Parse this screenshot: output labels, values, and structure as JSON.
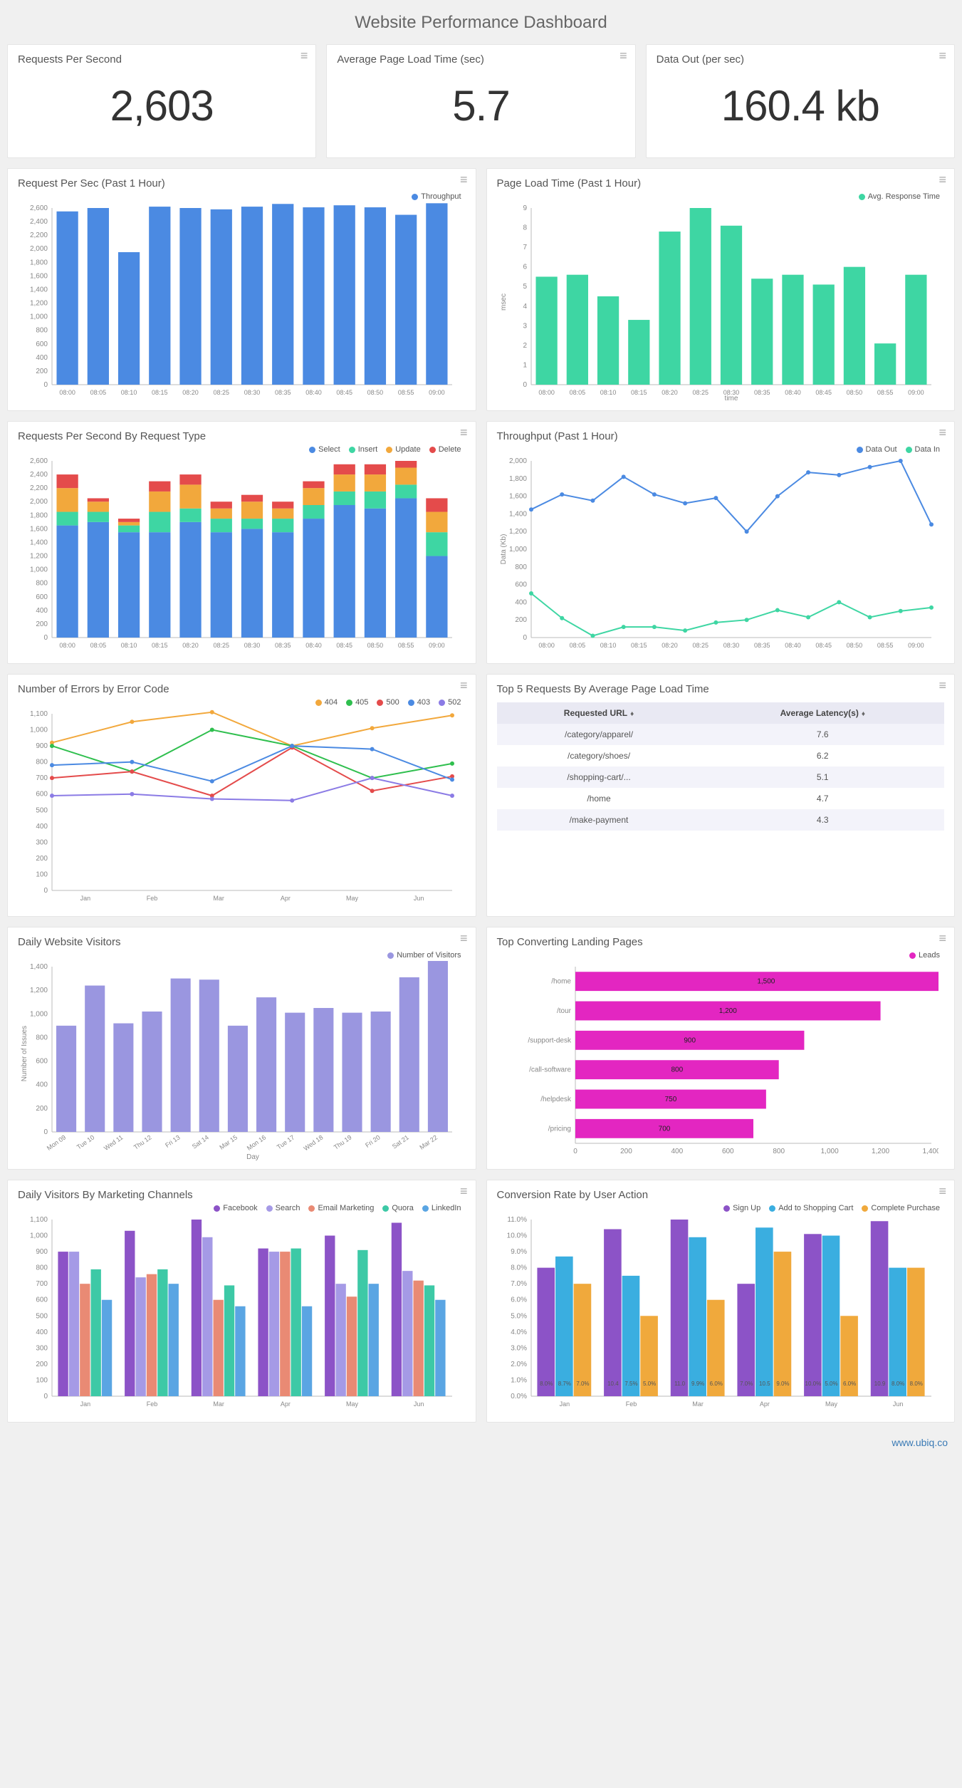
{
  "title": "Website Performance Dashboard",
  "footer": "www.ubiq.co",
  "kpis": {
    "rps": {
      "label": "Requests Per Second",
      "value": "2,603"
    },
    "plt": {
      "label": "Average Page Load Time (sec)",
      "value": "5.7"
    },
    "out": {
      "label": "Data Out (per sec)",
      "value": "160.4 kb"
    }
  },
  "colors": {
    "blue": "#4b8ae2",
    "teal": "#3ed6a3",
    "orange": "#f2a83c",
    "red": "#e44b4b",
    "green": "#2fbf4e",
    "purple": "#8b7be5",
    "lilac": "#9a96e0",
    "magenta": "#e326c1",
    "fbPurple": "#8c53c7",
    "searchLilac": "#a59ae6",
    "emailCoral": "#e98a74",
    "quoraTeal": "#3dc9a6",
    "linkedinBlue": "#5aa5e3",
    "signPurple": "#8c53c7",
    "cartBlue": "#3aaee0",
    "completeOrange": "#f0a93c"
  },
  "rps_hour": {
    "title": "Request Per Sec (Past 1 Hour)",
    "legend": "Throughput"
  },
  "plt_hour": {
    "title": "Page Load Time (Past 1 Hour)",
    "legend": "Avg. Response Time",
    "ylabel": "msec"
  },
  "rps_type": {
    "title": "Requests Per Second By Request Type",
    "legend": {
      "a": "Select",
      "b": "Insert",
      "c": "Update",
      "d": "Delete"
    }
  },
  "throughput": {
    "title": "Throughput (Past 1 Hour)",
    "legend": {
      "a": "Data Out",
      "b": "Data In"
    },
    "ylabel": "Data (Kb)"
  },
  "errors": {
    "title": "Number of Errors by Error Code",
    "legend": {
      "a": "404",
      "b": "405",
      "c": "500",
      "d": "403",
      "e": "502"
    }
  },
  "top5": {
    "title": "Top 5 Requests By Average Page Load Time",
    "col1": "Requested URL",
    "col2": "Average Latency(s)",
    "rows": [
      {
        "url": "/category/apparel/",
        "lat": "7.6"
      },
      {
        "url": "/category/shoes/",
        "lat": "6.2"
      },
      {
        "url": "/shopping-cart/...",
        "lat": "5.1"
      },
      {
        "url": "/home",
        "lat": "4.7"
      },
      {
        "url": "/make-payment",
        "lat": "4.3"
      }
    ]
  },
  "visitors": {
    "title": "Daily Website Visitors",
    "legend": "Number of Visitors",
    "ylabel": "Number of Issues",
    "xlabel": "Day"
  },
  "landing": {
    "title": "Top Converting Landing Pages",
    "legend": "Leads"
  },
  "channels": {
    "title": "Daily Visitors By Marketing Channels",
    "legend": {
      "a": "Facebook",
      "b": "Search",
      "c": "Email Marketing",
      "d": "Quora",
      "e": "LinkedIn"
    }
  },
  "conversion": {
    "title": "Conversion Rate by User Action",
    "legend": {
      "a": "Sign Up",
      "b": "Add to Shopping Cart",
      "c": "Complete Purchase"
    }
  },
  "chart_data": [
    {
      "id": "rps_hour",
      "type": "bar",
      "categories": [
        "08:00",
        "08:05",
        "08:10",
        "08:15",
        "08:20",
        "08:25",
        "08:30",
        "08:35",
        "08:40",
        "08:45",
        "08:50",
        "08:55",
        "09:00"
      ],
      "series": [
        {
          "name": "Throughput",
          "values": [
            2550,
            2600,
            1950,
            2620,
            2600,
            2580,
            2620,
            2660,
            2610,
            2640,
            2610,
            2500,
            2670
          ]
        }
      ],
      "ylim": [
        0,
        2600
      ],
      "yticks": [
        0,
        200,
        400,
        600,
        800,
        1000,
        1200,
        1400,
        1600,
        1800,
        2000,
        2200,
        2400,
        2600
      ]
    },
    {
      "id": "plt_hour",
      "type": "bar",
      "categories": [
        "08:00",
        "08:05",
        "08:10",
        "08:15",
        "08:20",
        "08:25",
        "08:30",
        "08:35",
        "08:40",
        "08:45",
        "08:50",
        "08:55",
        "09:00"
      ],
      "series": [
        {
          "name": "Avg. Response Time",
          "values": [
            5.5,
            5.6,
            4.5,
            3.3,
            7.8,
            9.0,
            8.1,
            5.4,
            5.6,
            5.1,
            6.0,
            2.1,
            5.6
          ]
        }
      ],
      "ylim": [
        0,
        9
      ],
      "yticks": [
        0,
        1,
        2,
        3,
        4,
        5,
        6,
        7,
        8,
        9
      ],
      "xlabel": "time"
    },
    {
      "id": "rps_type",
      "type": "stacked-bar",
      "categories": [
        "08:00",
        "08:05",
        "08:10",
        "08:15",
        "08:20",
        "08:25",
        "08:30",
        "08:35",
        "08:40",
        "08:45",
        "08:50",
        "08:55",
        "09:00"
      ],
      "series": [
        {
          "name": "Select",
          "values": [
            1650,
            1700,
            1550,
            1550,
            1700,
            1550,
            1600,
            1550,
            1750,
            1950,
            1900,
            2050,
            1200
          ]
        },
        {
          "name": "Insert",
          "values": [
            200,
            150,
            100,
            300,
            200,
            200,
            150,
            200,
            200,
            200,
            250,
            200,
            350
          ]
        },
        {
          "name": "Update",
          "values": [
            350,
            150,
            50,
            300,
            350,
            150,
            250,
            150,
            250,
            250,
            250,
            250,
            300
          ]
        },
        {
          "name": "Delete",
          "values": [
            200,
            50,
            50,
            150,
            150,
            100,
            100,
            100,
            100,
            150,
            150,
            100,
            200
          ]
        }
      ],
      "ylim": [
        0,
        2600
      ],
      "yticks": [
        0,
        200,
        400,
        600,
        800,
        1000,
        1200,
        1400,
        1600,
        1800,
        2000,
        2200,
        2400,
        2600
      ]
    },
    {
      "id": "throughput",
      "type": "line",
      "categories": [
        "08:00",
        "08:05",
        "08:10",
        "08:15",
        "08:20",
        "08:25",
        "08:30",
        "08:35",
        "08:40",
        "08:45",
        "08:50",
        "08:55",
        "09:00"
      ],
      "series": [
        {
          "name": "Data Out",
          "values": [
            1450,
            1620,
            1550,
            1820,
            1620,
            1520,
            1580,
            1200,
            1600,
            1870,
            1840,
            1930,
            2000,
            1280
          ]
        },
        {
          "name": "Data In",
          "values": [
            500,
            220,
            20,
            120,
            120,
            80,
            170,
            200,
            310,
            230,
            400,
            230,
            300,
            340
          ]
        }
      ],
      "ylim": [
        0,
        2000
      ],
      "yticks": [
        0,
        200,
        400,
        600,
        800,
        1000,
        1200,
        1400,
        1600,
        1800,
        2000
      ]
    },
    {
      "id": "errors",
      "type": "line",
      "categories": [
        "Jan",
        "Feb",
        "Mar",
        "Apr",
        "May",
        "Jun"
      ],
      "series": [
        {
          "name": "404",
          "values": [
            920,
            1050,
            1110,
            900,
            1010,
            1090
          ]
        },
        {
          "name": "405",
          "values": [
            900,
            740,
            1000,
            900,
            700,
            790
          ]
        },
        {
          "name": "500",
          "values": [
            700,
            740,
            590,
            890,
            620,
            710
          ]
        },
        {
          "name": "403",
          "values": [
            780,
            800,
            680,
            900,
            880,
            690
          ]
        },
        {
          "name": "502",
          "values": [
            590,
            600,
            570,
            560,
            700,
            590
          ]
        }
      ],
      "ylim": [
        0,
        1100
      ],
      "yticks": [
        0,
        100,
        200,
        300,
        400,
        500,
        600,
        700,
        800,
        900,
        1000,
        1100
      ]
    },
    {
      "id": "visitors",
      "type": "bar",
      "categories": [
        "Mon 09",
        "Tue 10",
        "Wed 11",
        "Thu 12",
        "Fri 13",
        "Sat 14",
        "Mar 15",
        "Mon 16",
        "Tue 17",
        "Wed 18",
        "Thu 19",
        "Fri 20",
        "Sat 21",
        "Mar 22"
      ],
      "series": [
        {
          "name": "Number of Visitors",
          "values": [
            900,
            1240,
            920,
            1020,
            1300,
            1290,
            900,
            1140,
            1010,
            1050,
            1010,
            1020,
            1310,
            1490
          ]
        }
      ],
      "ylim": [
        0,
        1400
      ],
      "yticks": [
        0,
        200,
        400,
        600,
        800,
        1000,
        1200,
        1400
      ]
    },
    {
      "id": "landing",
      "type": "bar-h",
      "categories": [
        "/home",
        "/tour",
        "/support-desk",
        "/call-software",
        "/helpdesk",
        "/pricing"
      ],
      "series": [
        {
          "name": "Leads",
          "values": [
            1500,
            1200,
            900,
            800,
            750,
            700
          ]
        }
      ],
      "xlim": [
        0,
        1400
      ],
      "xticks": [
        0,
        200,
        400,
        600,
        800,
        1000,
        1200,
        1400
      ]
    },
    {
      "id": "channels",
      "type": "grouped-bar",
      "categories": [
        "Jan",
        "Feb",
        "Mar",
        "Apr",
        "May",
        "Jun"
      ],
      "series": [
        {
          "name": "Facebook",
          "values": [
            900,
            1030,
            1100,
            920,
            1000,
            1080
          ]
        },
        {
          "name": "Search",
          "values": [
            900,
            740,
            990,
            900,
            700,
            780
          ]
        },
        {
          "name": "Email Marketing",
          "values": [
            700,
            760,
            600,
            900,
            620,
            720
          ]
        },
        {
          "name": "Quora",
          "values": [
            790,
            790,
            690,
            920,
            910,
            690
          ]
        },
        {
          "name": "LinkedIn",
          "values": [
            600,
            700,
            560,
            560,
            700,
            600
          ]
        }
      ],
      "ylim": [
        0,
        1100
      ],
      "yticks": [
        0,
        100,
        200,
        300,
        400,
        500,
        600,
        700,
        800,
        900,
        1000,
        1100
      ]
    },
    {
      "id": "conversion",
      "type": "grouped-bar",
      "categories": [
        "Jan",
        "Feb",
        "Mar",
        "Apr",
        "May",
        "Jun"
      ],
      "series": [
        {
          "name": "Sign Up",
          "values": [
            8.0,
            10.4,
            11.0,
            7.0,
            10.1,
            10.9
          ]
        },
        {
          "name": "Add to Shopping Cart",
          "values": [
            8.7,
            7.5,
            9.9,
            10.5,
            10.0,
            8.0
          ]
        },
        {
          "name": "Complete Purchase",
          "values": [
            7.0,
            5.0,
            6.0,
            9.0,
            5.0,
            8.0
          ]
        }
      ],
      "labels_pct": [
        [
          "8.0%",
          "8.7%",
          "7.0%"
        ],
        [
          "10.4",
          "7.5%",
          "5.0%"
        ],
        [
          "11.0",
          "9.9%",
          "6.0%"
        ],
        [
          "7.0%",
          "10.5",
          "9.0%"
        ],
        [
          "10.0%",
          "5.0%",
          "6.0%"
        ],
        [
          "10.9",
          "8.0%",
          "8.0%"
        ]
      ],
      "ylim": [
        0,
        11
      ],
      "yticks": [
        0,
        1,
        2,
        3,
        4,
        5,
        6,
        7,
        8,
        9,
        10,
        11
      ],
      "y_suffix": ".0%"
    }
  ]
}
